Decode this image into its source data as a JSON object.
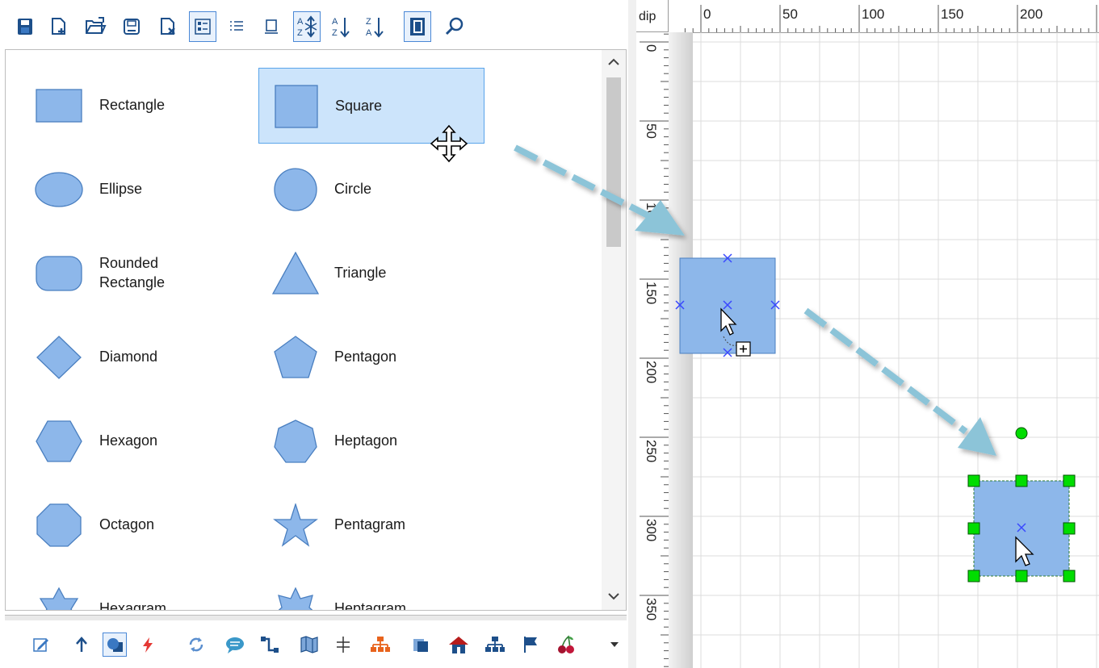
{
  "toolbar": {
    "buttons": [
      {
        "name": "save-icon",
        "active": false
      },
      {
        "name": "new-file-icon",
        "active": false
      },
      {
        "name": "open-folder-icon",
        "active": false
      },
      {
        "name": "save-as-icon",
        "active": false
      },
      {
        "name": "close-file-icon",
        "active": false
      },
      {
        "name": "icon-view-icon",
        "active": true
      },
      {
        "name": "list-view-icon",
        "active": false
      },
      {
        "name": "single-view-icon",
        "active": false
      },
      {
        "name": "sort-az-toggle-icon",
        "active": true
      },
      {
        "name": "sort-ascending-icon",
        "active": false
      },
      {
        "name": "sort-descending-icon",
        "active": false
      },
      {
        "name": "book-icon",
        "active": true
      },
      {
        "name": "search-icon",
        "active": false
      }
    ]
  },
  "palette": {
    "items": [
      {
        "label": "Rectangle",
        "shape": "rectangle"
      },
      {
        "label": "Square",
        "shape": "square",
        "selected": true
      },
      {
        "label": "Ellipse",
        "shape": "ellipse"
      },
      {
        "label": "Circle",
        "shape": "circle"
      },
      {
        "label": "Rounded\nRectangle",
        "shape": "rounded-rectangle"
      },
      {
        "label": "Triangle",
        "shape": "triangle"
      },
      {
        "label": "Diamond",
        "shape": "diamond"
      },
      {
        "label": "Pentagon",
        "shape": "pentagon"
      },
      {
        "label": "Hexagon",
        "shape": "hexagon"
      },
      {
        "label": "Heptagon",
        "shape": "heptagon"
      },
      {
        "label": "Octagon",
        "shape": "octagon"
      },
      {
        "label": "Pentagram",
        "shape": "pentagram"
      },
      {
        "label": "Hexagram",
        "shape": "hexagram"
      },
      {
        "label": "Heptagram",
        "shape": "heptagram"
      }
    ]
  },
  "bottom_toolbar": {
    "buttons": [
      {
        "name": "edit-icon",
        "active": false
      },
      {
        "name": "arrow-up-icon",
        "active": false
      },
      {
        "name": "shapes-icon",
        "active": true
      },
      {
        "name": "lightning-icon",
        "active": false
      },
      {
        "name": "refresh-icon",
        "active": false
      },
      {
        "name": "speech-bubble-icon",
        "active": false
      },
      {
        "name": "connector-icon",
        "active": false
      },
      {
        "name": "map-icon",
        "active": false
      },
      {
        "name": "split-icon",
        "active": false
      },
      {
        "name": "org-chart-icon",
        "active": false
      },
      {
        "name": "pages-icon",
        "active": false
      },
      {
        "name": "house-icon",
        "active": false
      },
      {
        "name": "hierarchy-icon",
        "active": false
      },
      {
        "name": "flag-icon",
        "active": false
      },
      {
        "name": "cherry-icon",
        "active": false
      },
      {
        "name": "more-dropdown-icon",
        "active": false
      }
    ]
  },
  "canvas": {
    "unit_label": "dip",
    "h_ruler_labels": [
      "0",
      "50",
      "100",
      "150",
      "200"
    ],
    "v_ruler_labels": [
      "0",
      "50",
      "100",
      "150",
      "200",
      "250",
      "300",
      "350"
    ]
  },
  "colors": {
    "shape_fill": "#8db7ea",
    "shape_stroke": "#4a7fc0",
    "selection_bg": "#cce4fb",
    "selection_border": "#5aa4ea",
    "arrow": "#8cc4d8",
    "handle": "#00dd00",
    "anchor": "#3a48ff"
  }
}
